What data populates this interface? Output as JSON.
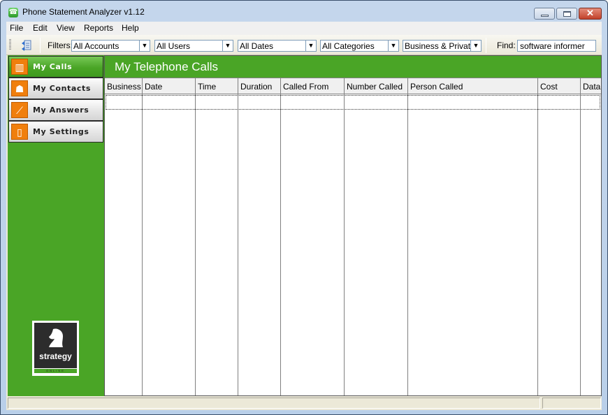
{
  "window": {
    "title": "Phone Statement Analyzer v1.12",
    "controls": {
      "minimize": "minimize",
      "maximize": "maximize",
      "close": "✕"
    }
  },
  "menu": [
    "File",
    "Edit",
    "View",
    "Reports",
    "Help"
  ],
  "toolbar": {
    "refresh_icon": "refresh-icon",
    "filters_label": "Filters:",
    "filters": [
      {
        "name": "accounts",
        "value": "All Accounts"
      },
      {
        "name": "users",
        "value": "All Users"
      },
      {
        "name": "dates",
        "value": "All Dates"
      },
      {
        "name": "categories",
        "value": "All Categories"
      },
      {
        "name": "call-type",
        "value": "Business & Private"
      }
    ],
    "find_label": "Find:",
    "find_value": "software informer"
  },
  "sidebar": {
    "items": [
      {
        "label": "My Calls",
        "icon": "book-icon",
        "active": true
      },
      {
        "label": "My Contacts",
        "icon": "people-icon",
        "active": false
      },
      {
        "label": "My Answers",
        "icon": "chart-icon",
        "active": false
      },
      {
        "label": "My Settings",
        "icon": "phone-icon",
        "active": false
      }
    ],
    "logo": {
      "text": "strategy",
      "subtext": "ONLINE"
    }
  },
  "main": {
    "title": "My Telephone Calls",
    "columns": [
      "Business",
      "Date",
      "Time",
      "Duration",
      "Called From",
      "Number Called",
      "Person Called",
      "Cost",
      "Data"
    ],
    "rows": []
  },
  "colors": {
    "brand_green": "#4aa526",
    "nav_orange": "#f07f0d"
  }
}
